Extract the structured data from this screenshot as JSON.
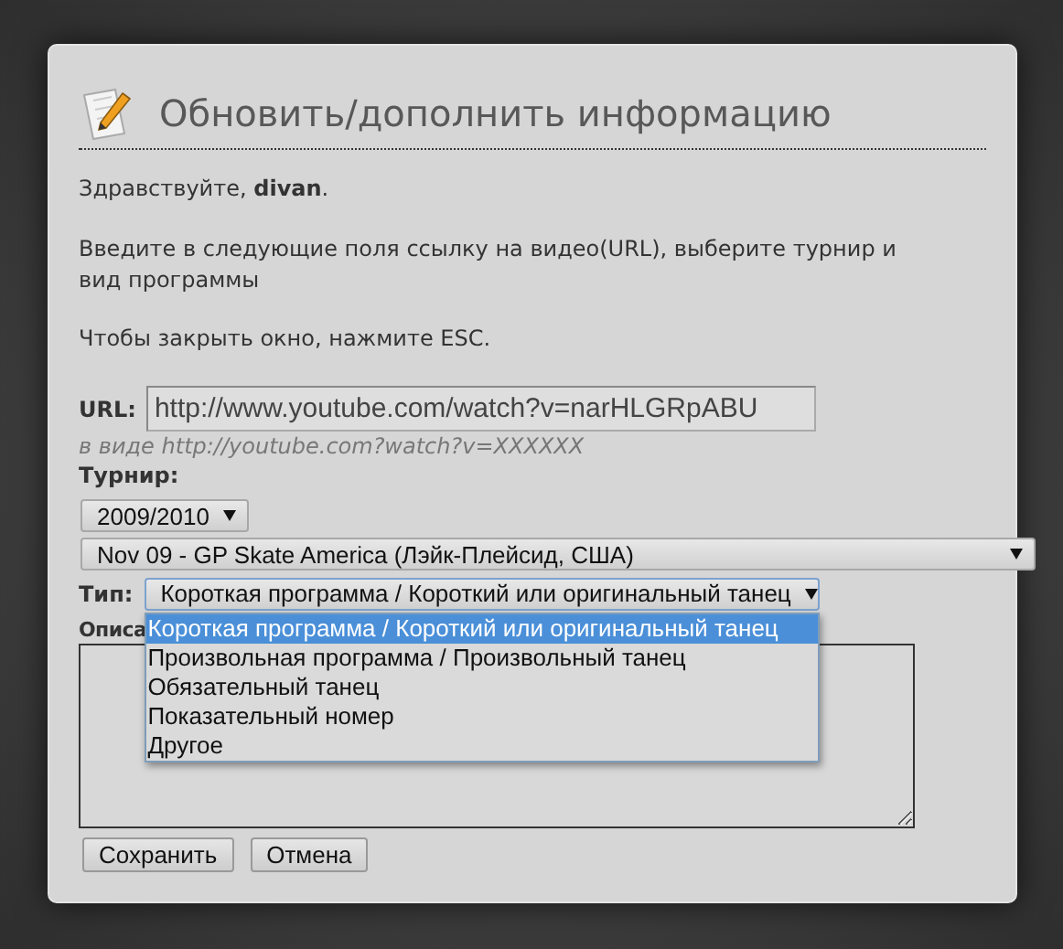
{
  "dialog": {
    "title": "Обновить/дополнить информацию",
    "greeting": "Здравствуйте, **divan**.",
    "instructions": "Введите в следующие поля ссылку на видео(URL), выберите турнир и вид программы",
    "close_hint": "Чтобы закрыть окно, нажмите ESC."
  },
  "url": {
    "label": "URL:",
    "value": "http://www.youtube.com/watch?v=narHLGRpABU",
    "hint": "в виде http://youtube.com?watch?v=XXXXXX"
  },
  "tournament": {
    "label": "Турнир:",
    "season": "2009/2010",
    "event": "Nov 09 - GP Skate America (Лэйк-Плейсид, США)"
  },
  "type": {
    "label": "Тип:",
    "value": "Короткая программа / Короткий или оригинальный танец",
    "expanded": true,
    "options": [
      {
        "label": "Короткая программа / Короткий или оригинальный танец",
        "selected": true
      },
      {
        "label": "Произвольная программа / Произвольный танец",
        "selected": false
      },
      {
        "label": "Обязательный танец",
        "selected": false
      },
      {
        "label": "Показательный номер",
        "selected": false
      },
      {
        "label": "Другое",
        "selected": false
      }
    ]
  },
  "description": {
    "label": "Описа"
  },
  "buttons": [
    {
      "label": "Сохранить"
    },
    {
      "label": "Отмена"
    }
  ]
}
